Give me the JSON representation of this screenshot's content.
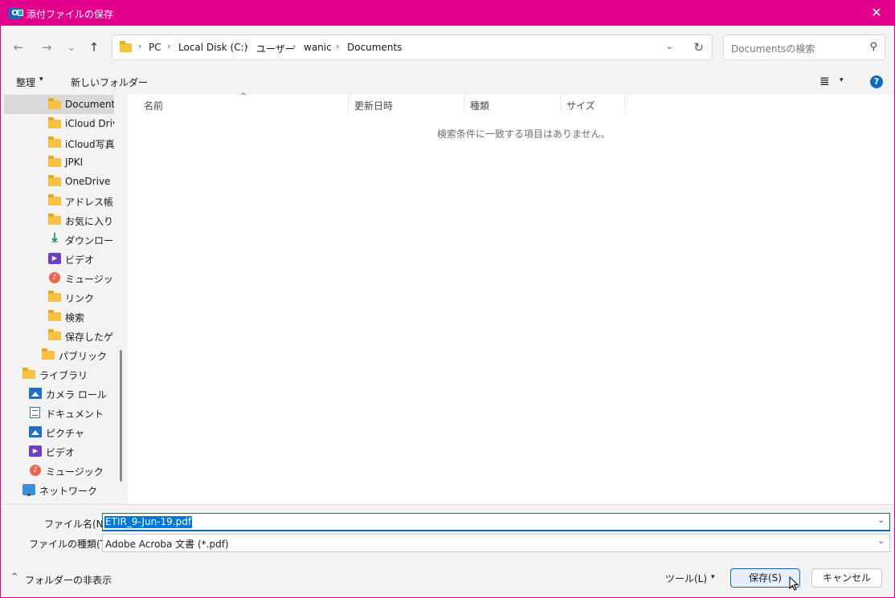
{
  "title": "添付ファイルの保存",
  "title_close": "✕",
  "nav": {
    "back": "←",
    "forward": "→",
    "recent": "⌄",
    "up": "↑"
  },
  "breadcrumbs": [
    "PC",
    "Local Disk (C:)",
    "ユーザー",
    "wanic",
    "Documents"
  ],
  "crumb_sep": "›",
  "address_dropdown": "⌄",
  "refresh": "↻",
  "search": {
    "placeholder": "Documentsの検索",
    "icon": "⚲"
  },
  "toolbar": {
    "organize": "整理",
    "caret": "▾",
    "new_folder": "新しいフォルダー",
    "view_icon": "≣",
    "help": "?"
  },
  "sidebar": {
    "items": [
      {
        "label": "Documents",
        "icon": "folder"
      },
      {
        "label": "iCloud Drive",
        "icon": "folder"
      },
      {
        "label": "iCloud写真",
        "icon": "folder"
      },
      {
        "label": "JPKI",
        "icon": "folder"
      },
      {
        "label": "OneDrive",
        "icon": "folder"
      },
      {
        "label": "アドレス帳",
        "icon": "folder"
      },
      {
        "label": "お気に入り",
        "icon": "folder"
      },
      {
        "label": "ダウンロード",
        "icon": "download"
      },
      {
        "label": "ビデオ",
        "icon": "video"
      },
      {
        "label": "ミュージック",
        "icon": "music"
      },
      {
        "label": "リンク",
        "icon": "folder"
      },
      {
        "label": "検索",
        "icon": "folder"
      },
      {
        "label": "保存したゲーム",
        "icon": "folder"
      },
      {
        "label": "パブリック",
        "icon": "folder"
      },
      {
        "label": "ライブラリ",
        "icon": "folder"
      },
      {
        "label": "カメラ ロール",
        "icon": "pictures"
      },
      {
        "label": "ドキュメント",
        "icon": "documents"
      },
      {
        "label": "ピクチャ",
        "icon": "pictures"
      },
      {
        "label": "ビデオ",
        "icon": "video"
      },
      {
        "label": "ミュージック",
        "icon": "music"
      },
      {
        "label": "ネットワーク",
        "icon": "network"
      }
    ]
  },
  "columns": [
    "名前",
    "更新日時",
    "種類",
    "サイズ"
  ],
  "sort_indicator": "^",
  "empty_message": "検索条件に一致する項目はありません。",
  "form": {
    "filename_label": "ファイル名(N):",
    "filename_value": "ETIR_9-Jun-19.pdf",
    "filetype_label": "ファイルの種類(T):",
    "filetype_value": "Adobe Acroba 文書 (*.pdf)",
    "caret": "⌄"
  },
  "footer": {
    "hide_folders": "フォルダーの非表示",
    "hide_caret": "^",
    "tools": "ツール(L)",
    "tools_caret": "▾",
    "save": "保存(S)",
    "cancel": "キャンセル"
  },
  "colors": {
    "accent": "#e3008c",
    "selection": "#0078d7",
    "folder": "#f6c141"
  }
}
